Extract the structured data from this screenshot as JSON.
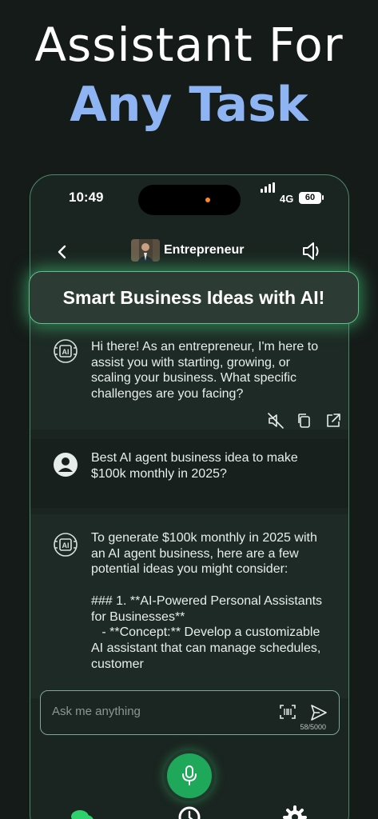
{
  "promo": {
    "headline_line1": "Assistant For",
    "headline_line2": "Any Task",
    "headline_accent_color": "#8eb4f4"
  },
  "status_bar": {
    "time": "10:49",
    "network": "4G",
    "battery": "60"
  },
  "header": {
    "title": "Entrepreneur",
    "back_icon": "chevron-left-icon",
    "speaker_icon": "speaker-icon"
  },
  "banner": {
    "text": "Smart Business Ideas with AI!"
  },
  "messages": [
    {
      "role": "assistant",
      "text": "Hi there! As an entrepreneur, I'm here to assist you with starting, growing, or scaling your business. What specific challenges are you facing?"
    },
    {
      "role": "user",
      "text": "Best AI agent business idea to make $100k monthly in 2025?"
    },
    {
      "role": "assistant",
      "text": "To generate $100k monthly in 2025 with an AI agent business, here are a few potential ideas you might consider:\n\n### 1. **AI-Powered Personal Assistants for Businesses**\n   - **Concept:** Develop a customizable AI assistant that can manage schedules, customer"
    }
  ],
  "message_actions": [
    "mute-icon",
    "copy-icon",
    "share-icon"
  ],
  "composer": {
    "placeholder": "Ask me anything",
    "char_count": "58/5000",
    "scan_icon": "scan-icon",
    "send_icon": "send-icon"
  },
  "mic": {
    "icon": "microphone-icon",
    "color": "#1fa85a"
  },
  "bottom_nav": [
    "chat-icon",
    "history-icon",
    "settings-icon"
  ],
  "colors": {
    "background": "#151b19",
    "accent_green": "#5fbf8a"
  }
}
